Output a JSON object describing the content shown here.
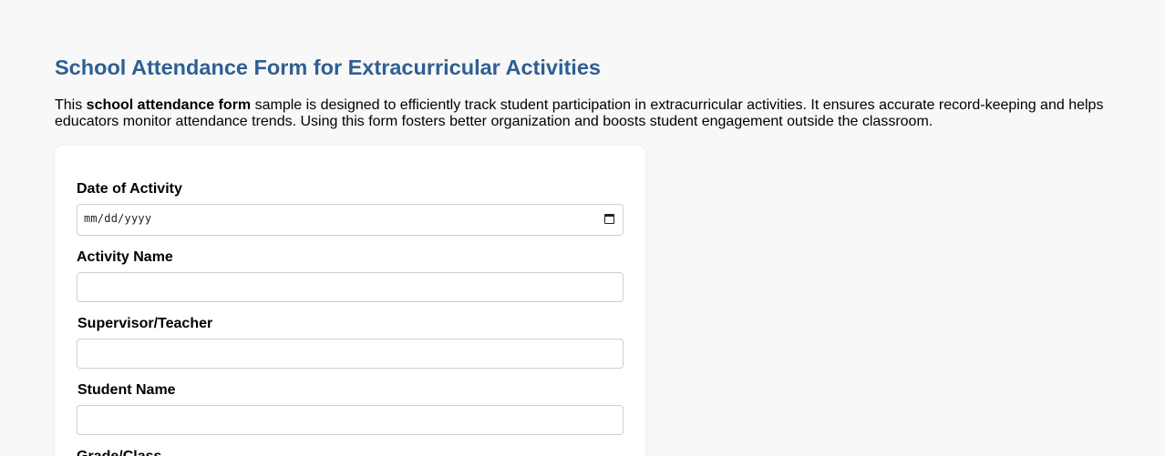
{
  "page": {
    "title": "School Attendance Form for Extracurricular Activities",
    "intro": {
      "prefix": "This ",
      "bold": "school attendance form",
      "suffix": " sample is designed to efficiently track student participation in extracurricular activities. It ensures accurate record-keeping and helps educators monitor attendance trends. Using this form fosters better organization and boosts student engagement outside the classroom."
    }
  },
  "form": {
    "date_label": "Date of Activity",
    "date_placeholder": "mm/dd/yyyy",
    "activity_label": "Activity Name",
    "activity_value": "",
    "supervisor_label": "Supervisor/Teacher",
    "supervisor_value": "",
    "student_label": "Student Name",
    "student_value": "",
    "grade_label": "Grade/Class"
  },
  "colors": {
    "title": "#2f5f92",
    "background": "#f8f8f8",
    "card": "#ffffff",
    "border": "#cfcfcf"
  },
  "icons": {
    "date_picker": "calendar-icon"
  }
}
